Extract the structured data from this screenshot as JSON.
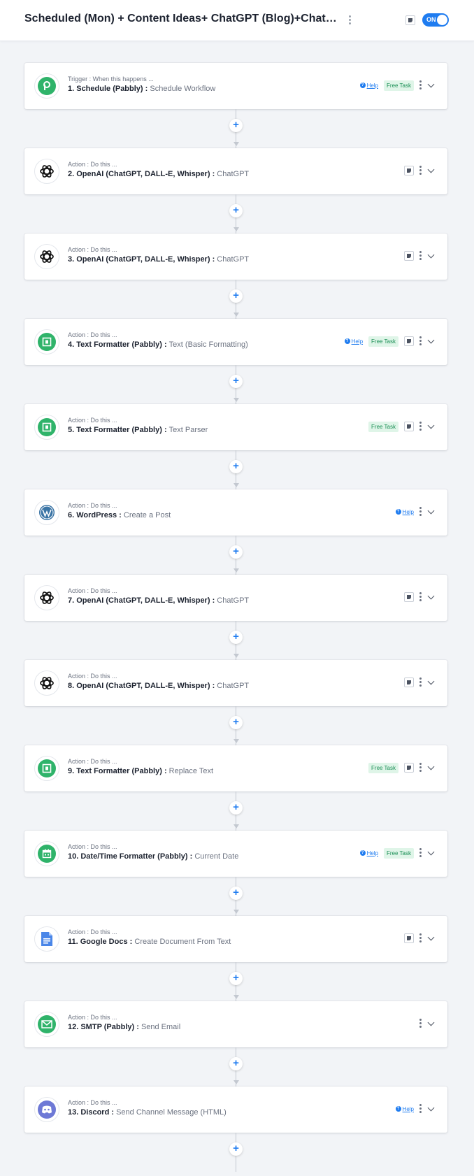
{
  "header": {
    "title": "Scheduled (Mon) + Content Ideas+ ChatGPT (Blog)+ChatGPT(Sc...",
    "toggle_label": "ON"
  },
  "colors": {
    "accent": "#1f7cf0",
    "free_task_bg": "#dff5e8",
    "free_task_text": "#1a8f55",
    "pabbly_green": "#2fb36a",
    "openai_black": "#111111"
  },
  "steps": [
    {
      "kind": "Trigger : When this happens ...",
      "app": "1. Schedule (Pabbly)",
      "sep": " : ",
      "event": "Schedule Workflow",
      "icon": "pabbly-icon",
      "help": "Help",
      "free": "Free Task"
    },
    {
      "kind": "Action : Do this ...",
      "app": "2. OpenAI (ChatGPT, DALL-E, Whisper)",
      "sep": " : ",
      "event": "ChatGPT",
      "icon": "openai-icon"
    },
    {
      "kind": "Action : Do this ...",
      "app": "3. OpenAI (ChatGPT, DALL-E, Whisper)",
      "sep": " : ",
      "event": "ChatGPT",
      "icon": "openai-icon"
    },
    {
      "kind": "Action : Do this ...",
      "app": "4. Text Formatter (Pabbly)",
      "sep": " : ",
      "event": "Text (Basic Formatting)",
      "icon": "text-formatter-icon",
      "help": "Help",
      "free": "Free Task"
    },
    {
      "kind": "Action : Do this ...",
      "app": "5. Text Formatter (Pabbly)",
      "sep": " : ",
      "event": "Text Parser",
      "icon": "text-formatter-icon",
      "free": "Free Task"
    },
    {
      "kind": "Action : Do this ...",
      "app": "6. WordPress",
      "sep": " : ",
      "event": "Create a Post",
      "icon": "wordpress-icon",
      "help": "Help"
    },
    {
      "kind": "Action : Do this ...",
      "app": "7. OpenAI (ChatGPT, DALL-E, Whisper)",
      "sep": " : ",
      "event": "ChatGPT",
      "icon": "openai-icon"
    },
    {
      "kind": "Action : Do this ...",
      "app": "8. OpenAI (ChatGPT, DALL-E, Whisper)",
      "sep": " : ",
      "event": "ChatGPT",
      "icon": "openai-icon"
    },
    {
      "kind": "Action : Do this ...",
      "app": "9. Text Formatter (Pabbly)",
      "sep": " : ",
      "event": "Replace Text",
      "icon": "text-formatter-icon",
      "free": "Free Task"
    },
    {
      "kind": "Action : Do this ...",
      "app": "10. Date/Time Formatter (Pabbly)",
      "sep": " : ",
      "event": "Current Date",
      "icon": "datetime-formatter-icon",
      "help": "Help",
      "free": "Free Task"
    },
    {
      "kind": "Action : Do this ...",
      "app": "11. Google Docs",
      "sep": " : ",
      "event": "Create Document From Text",
      "icon": "google-docs-icon"
    },
    {
      "kind": "Action : Do this ...",
      "app": "12. SMTP (Pabbly)",
      "sep": " : ",
      "event": "Send Email",
      "icon": "smtp-icon"
    },
    {
      "kind": "Action : Do this ...",
      "app": "13. Discord",
      "sep": " : ",
      "event": "Send Channel Message (HTML)",
      "icon": "discord-icon",
      "help": "Help"
    }
  ],
  "add_step_glyph": "+"
}
